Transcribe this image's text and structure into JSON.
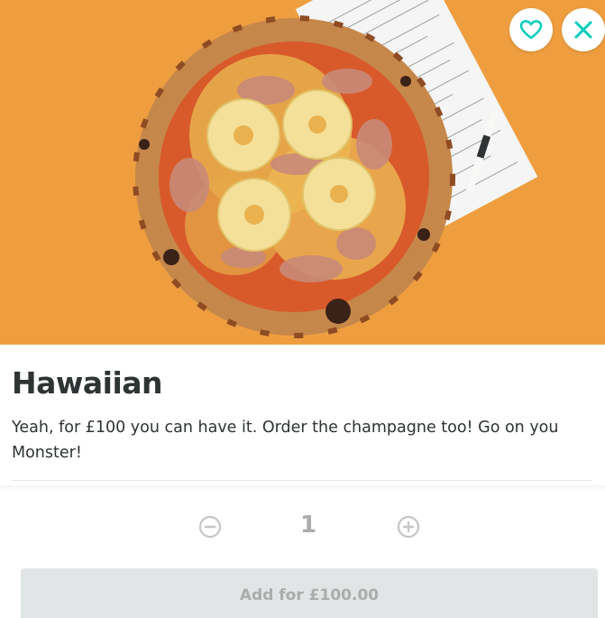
{
  "product": {
    "name": "Hawaiian",
    "description": "Yeah, for £100 you can have it. Order the champagne too! Go on you Monster!",
    "image_alt": "Hawaiian pizza with pineapple and ham on a tray"
  },
  "actions": {
    "favourite_icon": "heart-outline-icon",
    "close_icon": "close-x-icon"
  },
  "quantity": {
    "value": "1",
    "minus_icon": "minus-circle-icon",
    "plus_icon": "plus-circle-icon"
  },
  "add_button": {
    "label": "Add for £100.00"
  },
  "colors": {
    "accent": "#00ccbc",
    "hero_background": "#ef9e3f",
    "disabled_text": "#abadad",
    "disabled_button": "#e2e5e5",
    "text": "#2e3333"
  }
}
